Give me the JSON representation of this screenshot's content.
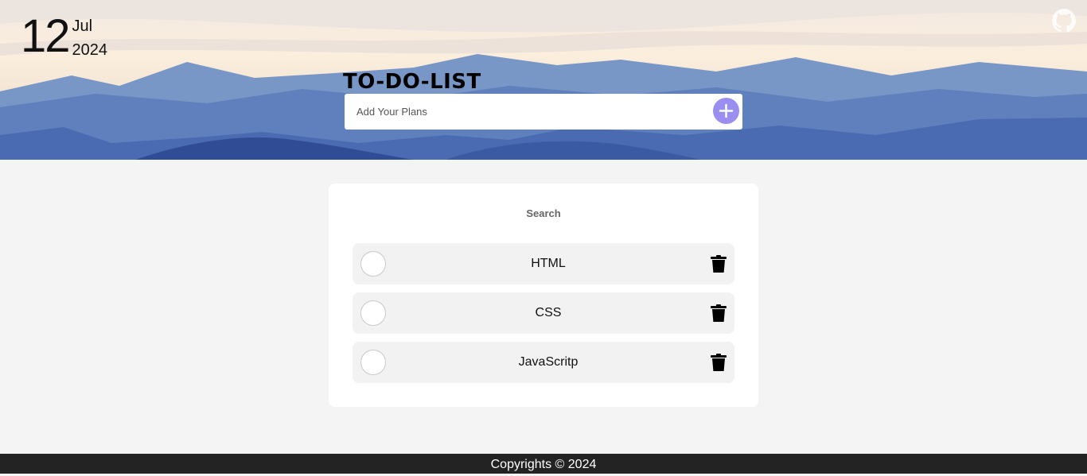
{
  "date": {
    "day": "12",
    "month": "Jul",
    "year": "2024"
  },
  "header": {
    "title": "TO-DO-LIST",
    "github_icon": "github-icon"
  },
  "add": {
    "placeholder": "Add Your Plans",
    "button_icon": "plus-icon"
  },
  "search": {
    "label": "Search"
  },
  "tasks": [
    {
      "label": "HTML",
      "done": false
    },
    {
      "label": "CSS",
      "done": false
    },
    {
      "label": "JavaScritp",
      "done": false
    }
  ],
  "footer": {
    "text": "Copyrights © 2024"
  },
  "colors": {
    "accent": "#9a8ff0",
    "footer_bg": "#232323",
    "card_bg": "#ffffff",
    "page_bg": "#f4f4f4"
  }
}
